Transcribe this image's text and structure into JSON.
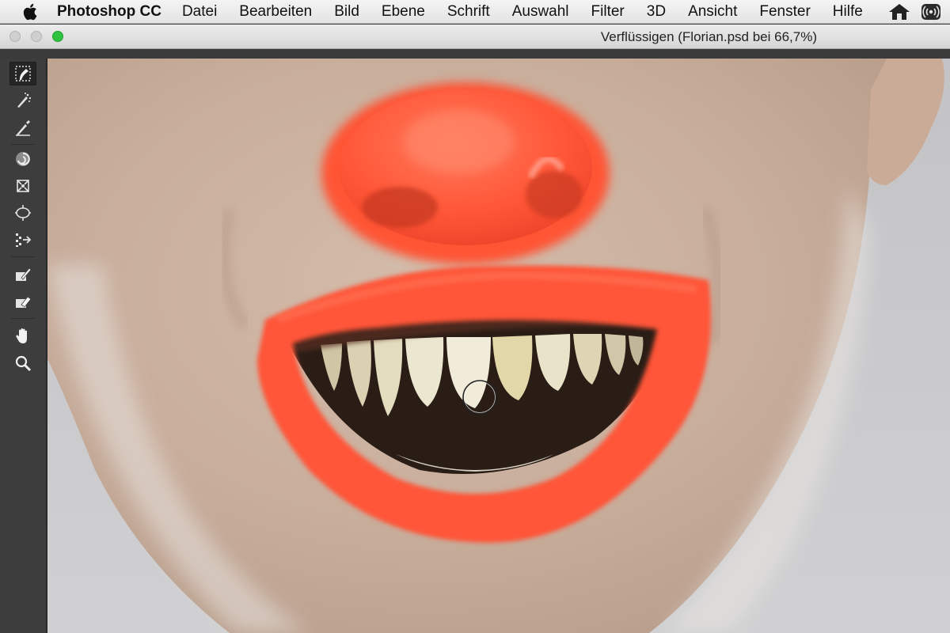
{
  "menubar": {
    "app_name": "Photoshop CC",
    "items": [
      "Datei",
      "Bearbeiten",
      "Bild",
      "Ebene",
      "Schrift",
      "Auswahl",
      "Filter",
      "3D",
      "Ansicht",
      "Fenster",
      "Hilfe"
    ],
    "right_icons": [
      "home-icon",
      "broadcast-icon"
    ]
  },
  "window": {
    "title": "Verflüssigen (Florian.psd bei 66,7%)",
    "zoom": "66,7%"
  },
  "tools": [
    {
      "name": "forward-warp-tool",
      "icon": "warp-icon",
      "active": true
    },
    {
      "name": "reconstruct-tool",
      "icon": "reconstruct-icon",
      "active": false
    },
    {
      "name": "smooth-tool",
      "icon": "smooth-icon",
      "active": false
    },
    {
      "name": "twirl-clockwise-tool",
      "icon": "twirl-icon",
      "active": false
    },
    {
      "name": "pucker-tool",
      "icon": "pucker-icon",
      "active": false
    },
    {
      "name": "bloat-tool",
      "icon": "bloat-icon",
      "active": false
    },
    {
      "name": "push-left-tool",
      "icon": "push-left-icon",
      "active": false
    },
    {
      "name": "freeze-mask-tool",
      "icon": "freeze-mask-icon",
      "active": false
    },
    {
      "name": "thaw-mask-tool",
      "icon": "thaw-mask-icon",
      "active": false
    },
    {
      "name": "hand-tool",
      "icon": "hand-icon",
      "active": false
    },
    {
      "name": "zoom-tool",
      "icon": "zoom-icon",
      "active": false
    }
  ],
  "colors": {
    "menubar_bg": "#ebebeb",
    "panel_bg": "#3d3d3d",
    "accent_green": "#2fc23f",
    "clown_paint": "#ff5a3a",
    "skin": "#cdb3a2",
    "background_wall": "#c9c9cb"
  }
}
